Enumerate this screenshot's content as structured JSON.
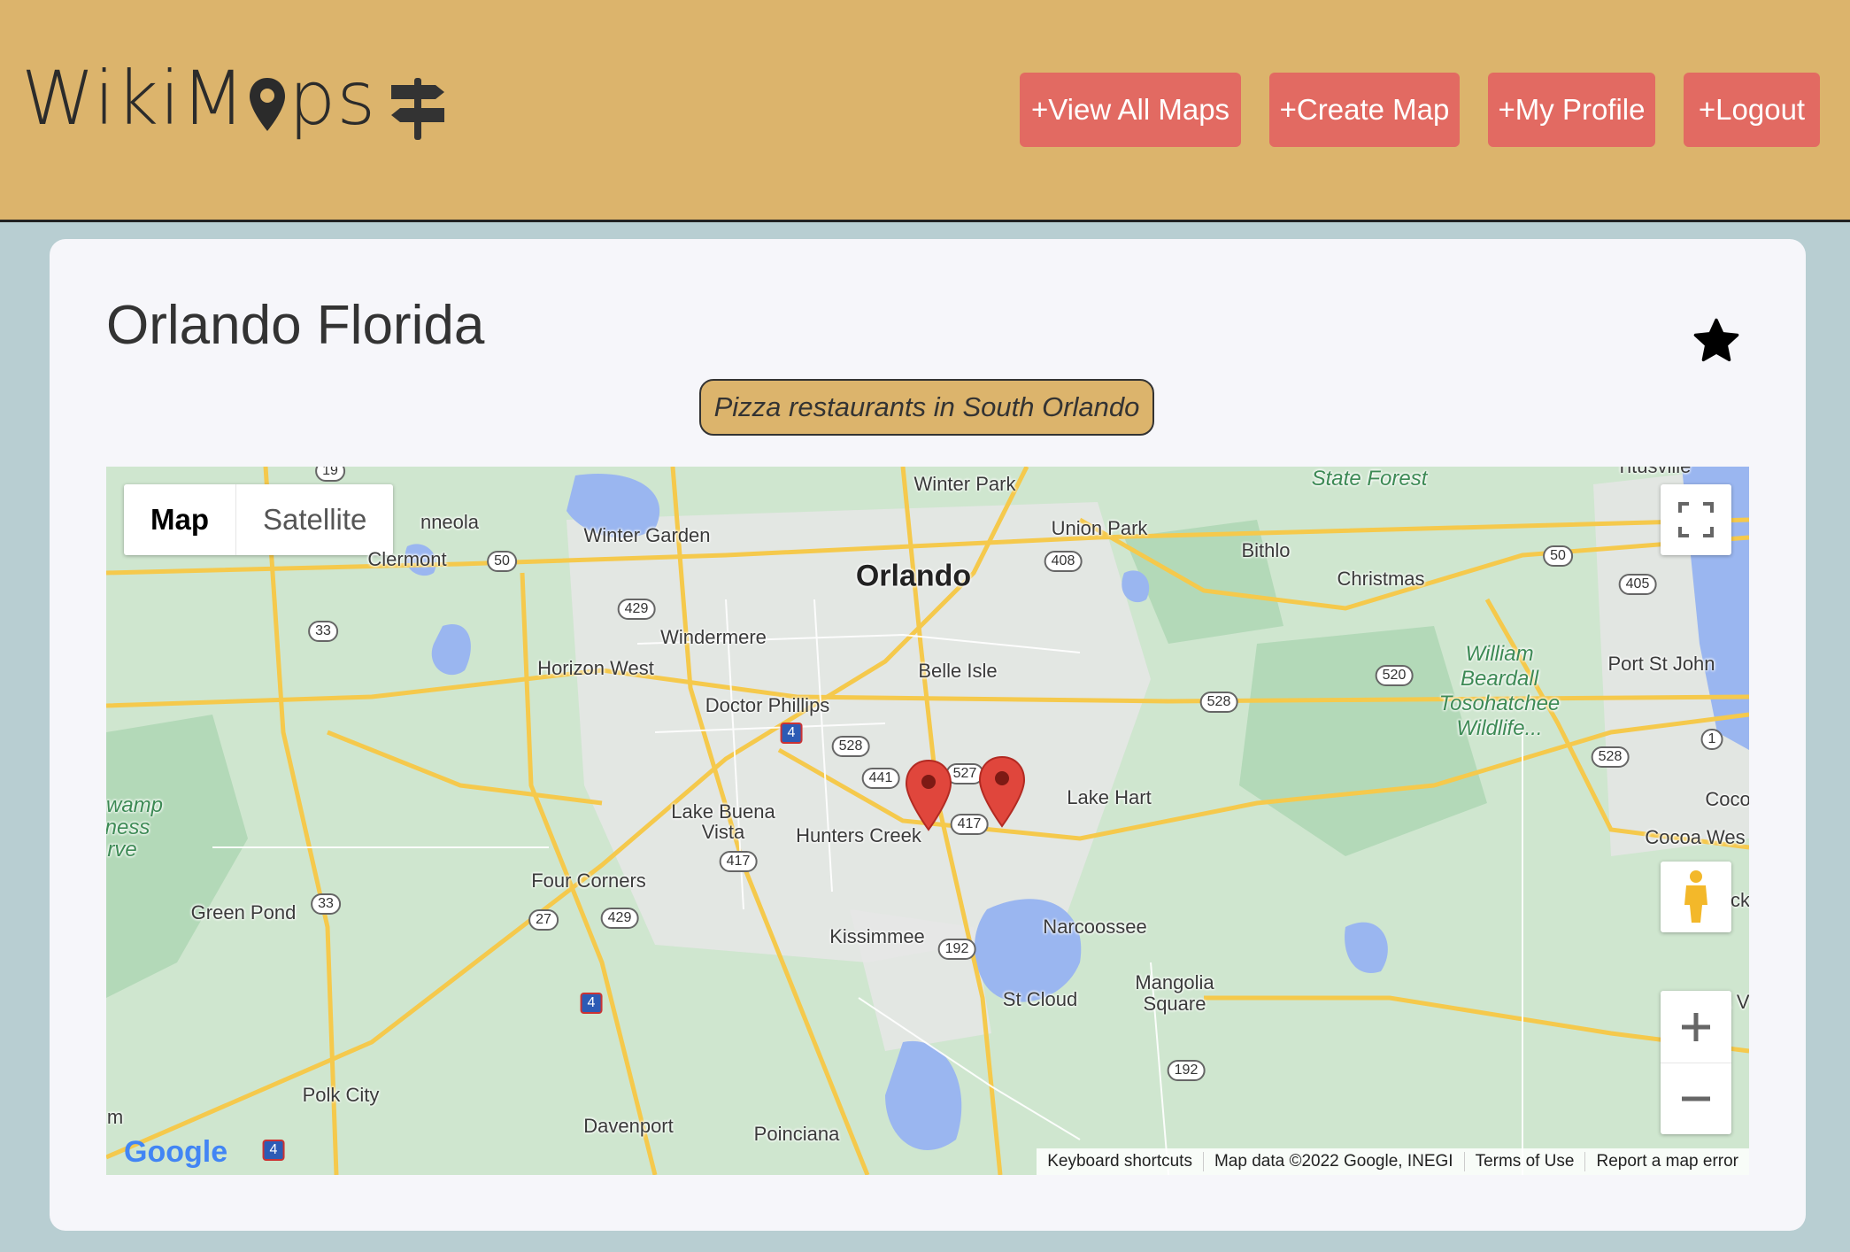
{
  "app": {
    "logo_text_left": "WikiM",
    "logo_text_right": "ps"
  },
  "nav": {
    "view_all_maps": "+View All Maps",
    "create_map": "+Create Map",
    "my_profile": "+My Profile",
    "logout": "+Logout"
  },
  "map_page": {
    "title": "Orlando Florida",
    "description": "Pizza restaurants in South Orlando"
  },
  "map": {
    "type_options": [
      "Map",
      "Satellite"
    ],
    "selected_type": "Map",
    "labels": {
      "orlando": "Orlando",
      "winter_park": "Winter Park",
      "winter_garden": "Winter Garden",
      "union_park": "Union Park",
      "bithlo": "Bithlo",
      "christmas": "Christmas",
      "clermont": "Clermont",
      "minneola": "nneola",
      "windermere": "Windermere",
      "horizon_west": "Horizon West",
      "belle_isle": "Belle Isle",
      "doctor_phillips": "Doctor Phillips",
      "lake_buena_vista_1": "Lake Buena",
      "lake_buena_vista_2": "Vista",
      "hunters_creek": "Hunters Creek",
      "lake_hart": "Lake Hart",
      "four_corners": "Four Corners",
      "green_pond": "Green Pond",
      "kissimmee": "Kissimmee",
      "narcoossee": "Narcoossee",
      "st_cloud": "St Cloud",
      "mangolia_1": "Mangolia",
      "mangolia_2": "Square",
      "polk_city": "Polk City",
      "davenport": "Davenport",
      "poinciana": "Poinciana",
      "port_st_john": "Port St John",
      "cocoa_west": "Cocoa Wes",
      "cocoa": "Coco",
      "titusville": "Titusville",
      "state_forest": "State Forest",
      "wb_1": "William",
      "wb_2": "Beardall",
      "wb_3": "Tosohatchee",
      "wb_4": "Wildlife...",
      "swamp_1": "wamp",
      "swamp_2": "ness",
      "swamp_3": "rve",
      "edge_ck": "ck",
      "edge_a": "a V",
      "edge_m": "m"
    },
    "shields": [
      "19",
      "50",
      "429",
      "408",
      "50",
      "405",
      "33",
      "528",
      "520",
      "528",
      "1",
      "528",
      "441",
      "527",
      "417",
      "417",
      "429",
      "27",
      "33",
      "192",
      "192"
    ],
    "interstate_shields": [
      "4",
      "4",
      "4"
    ],
    "google_logo": "Google",
    "footer": {
      "keyboard_shortcuts": "Keyboard shortcuts",
      "map_data": "Map data ©2022 Google, INEGI",
      "terms": "Terms of Use",
      "report": "Report a map error"
    },
    "markers": 2
  },
  "colors": {
    "header_bg": "#dcb46c",
    "button_bg": "#e26a62",
    "card_bg": "#f6f6fa",
    "page_bg": "#b8ced2",
    "marker_red": "#e0463c"
  }
}
